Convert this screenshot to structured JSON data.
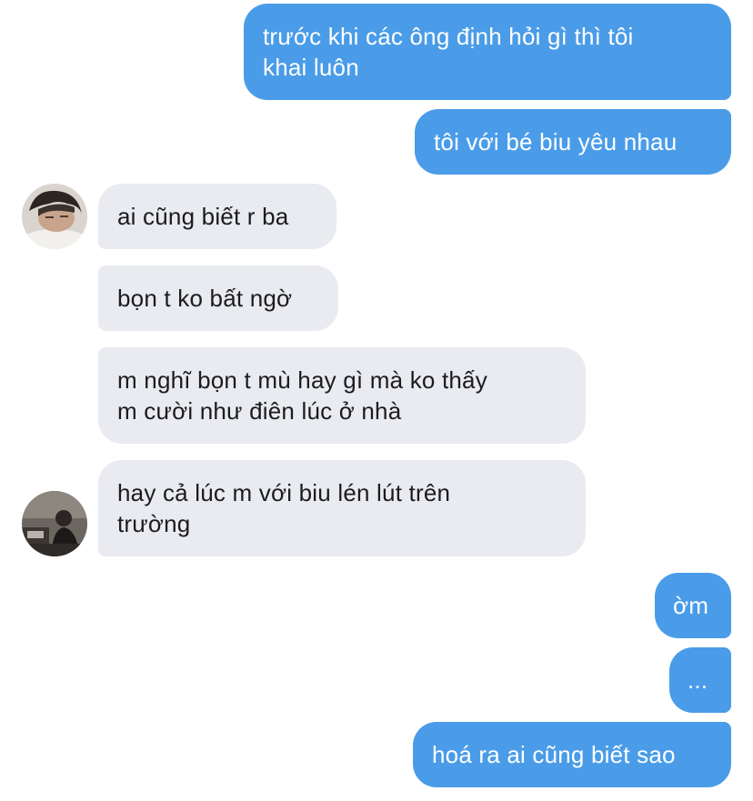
{
  "conversation": {
    "messages": [
      {
        "sender": "me",
        "text": "trước khi các ông định hỏi gì thì tôi\nkhai luôn"
      },
      {
        "sender": "me",
        "text": "tôi với bé biu yêu nhau"
      },
      {
        "sender": "friend_1",
        "text": "ai cũng biết r ba"
      },
      {
        "sender": "friend_1",
        "text": "bọn t ko bất ngờ"
      },
      {
        "sender": "friend_1",
        "text": "m nghĩ bọn t mù hay gì mà ko thấy\nm cười như điên lúc ở nhà"
      },
      {
        "sender": "friend_2",
        "text": "hay cả lúc m với biu lén lút trên\ntrường"
      },
      {
        "sender": "me",
        "text": "ờm"
      },
      {
        "sender": "me",
        "text": "..."
      },
      {
        "sender": "me",
        "text": "hoá ra ai cũng biết sao"
      }
    ]
  },
  "colors": {
    "outgoing_bubble": "#4a9ce8",
    "incoming_bubble": "#e9ebf0",
    "outgoing_text": "#ffffff",
    "incoming_text": "#1c1c1e"
  }
}
